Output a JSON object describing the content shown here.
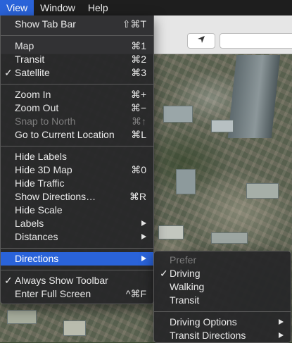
{
  "menubar": {
    "items": [
      "View",
      "Window",
      "Help"
    ]
  },
  "view_menu": {
    "show_tab_bar": {
      "label": "Show Tab Bar",
      "shortcut": "⇧⌘T"
    },
    "map": {
      "label": "Map",
      "shortcut": "⌘1"
    },
    "transit": {
      "label": "Transit",
      "shortcut": "⌘2"
    },
    "satellite": {
      "label": "Satellite",
      "shortcut": "⌘3",
      "checked": true
    },
    "zoom_in": {
      "label": "Zoom In",
      "shortcut": "⌘+"
    },
    "zoom_out": {
      "label": "Zoom Out",
      "shortcut": "⌘−"
    },
    "snap_to_north": {
      "label": "Snap to North",
      "shortcut": "⌘↑",
      "disabled": true
    },
    "go_to_current_location": {
      "label": "Go to Current Location",
      "shortcut": "⌘L"
    },
    "hide_labels": {
      "label": "Hide Labels"
    },
    "hide_3d_map": {
      "label": "Hide 3D Map",
      "shortcut": "⌘0"
    },
    "hide_traffic": {
      "label": "Hide Traffic"
    },
    "show_directions": {
      "label": "Show Directions…",
      "shortcut": "⌘R"
    },
    "hide_scale": {
      "label": "Hide Scale"
    },
    "labels": {
      "label": "Labels"
    },
    "distances": {
      "label": "Distances"
    },
    "directions": {
      "label": "Directions",
      "highlighted": true
    },
    "always_show_toolbar": {
      "label": "Always Show Toolbar",
      "checked": true
    },
    "enter_full_screen": {
      "label": "Enter Full Screen",
      "shortcut": "^⌘F"
    }
  },
  "directions_submenu": {
    "header": "Prefer",
    "driving": {
      "label": "Driving",
      "checked": true
    },
    "walking": {
      "label": "Walking"
    },
    "transit": {
      "label": "Transit"
    },
    "driving_options": {
      "label": "Driving Options"
    },
    "transit_directions": {
      "label": "Transit Directions"
    }
  },
  "check_glyph": "✓",
  "icons": {
    "location_arrow": "location-arrow-icon",
    "submenu_arrow": "chevron-right-icon"
  },
  "colors": {
    "highlight": "#2a63d9",
    "menu_bg": "#262628",
    "menubar_bg": "#1e1e1e"
  }
}
